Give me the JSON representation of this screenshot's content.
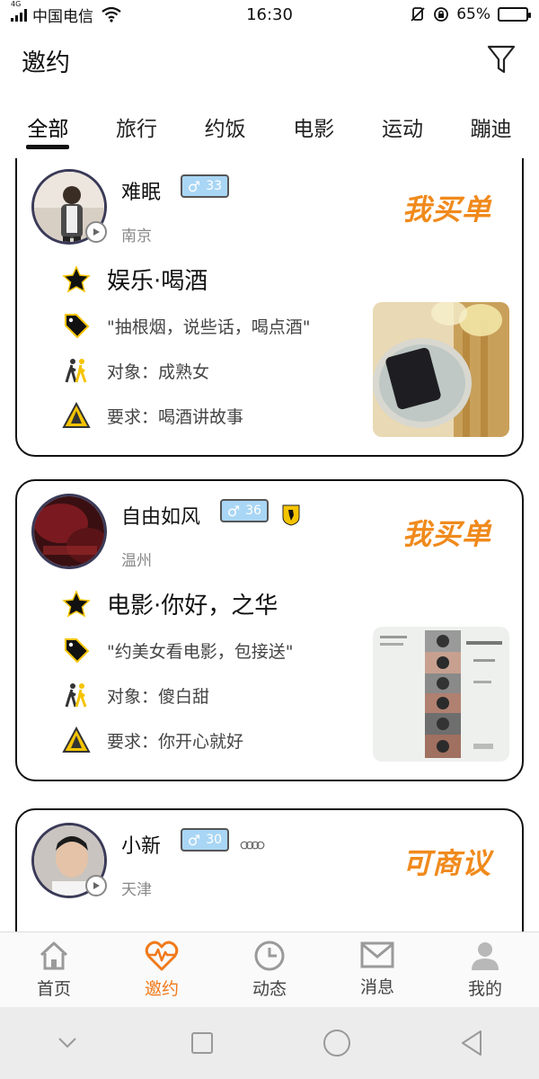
{
  "status_bar": {
    "network": "4G",
    "carrier": "中国电信",
    "time": "16:30",
    "battery": "65%",
    "battery_level": 0.65
  },
  "header": {
    "title": "邀约"
  },
  "tabs": [
    {
      "label": "全部",
      "active": true
    },
    {
      "label": "旅行"
    },
    {
      "label": "约饭"
    },
    {
      "label": "电影"
    },
    {
      "label": "运动"
    },
    {
      "label": "蹦迪"
    }
  ],
  "cards": [
    {
      "name": "难眠",
      "gender": "♂",
      "age": "33",
      "city": "南京",
      "pay": "我买单",
      "activity": "娱乐·喝酒",
      "quote": "\"抽根烟，说些话，喝点酒\"",
      "target": "对象：成熟女",
      "requirement": "要求：喝酒讲故事"
    },
    {
      "name": "自由如风",
      "gender": "♂",
      "age": "36",
      "city": "温州",
      "pay": "我买单",
      "activity": "电影·你好，之华",
      "quote": "\"约美女看电影，包接送\"",
      "target": "对象：傻白甜",
      "requirement": "要求：你开心就好"
    },
    {
      "name": "小新",
      "gender": "♂",
      "age": "30",
      "city": "天津",
      "pay": "可商议"
    }
  ],
  "bottom_nav": [
    {
      "label": "首页",
      "icon": "home-icon"
    },
    {
      "label": "邀约",
      "icon": "heartbeat-icon",
      "active": true
    },
    {
      "label": "动态",
      "icon": "clock-icon"
    },
    {
      "label": "消息",
      "icon": "mail-icon"
    },
    {
      "label": "我的",
      "icon": "user-icon"
    }
  ],
  "colors": {
    "accent": "#f07a1c",
    "badge": "#a9d6f5",
    "text": "#111111"
  }
}
